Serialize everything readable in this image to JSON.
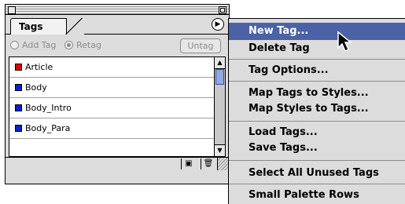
{
  "palette": {
    "tab_label": "Tags",
    "menu_button_icon": "triangle-right-icon",
    "options": {
      "add_tag_label": "Add Tag",
      "retag_label": "Retag",
      "selected": "Retag",
      "untag_label": "Untag"
    },
    "tags": [
      {
        "name": "Article",
        "color": "#e00000"
      },
      {
        "name": "Body",
        "color": "#0a1fd0"
      },
      {
        "name": "Body_Intro",
        "color": "#0a1fd0"
      },
      {
        "name": "Body_Para",
        "color": "#0a1fd0"
      }
    ],
    "bottom_icons": [
      "new-tag-icon",
      "trash-icon"
    ]
  },
  "menu": {
    "items": [
      {
        "label": "New Tag...",
        "highlighted": true
      },
      {
        "label": "Delete Tag"
      },
      {
        "label": "Tag Options..."
      },
      {
        "label": "Map Tags to Styles..."
      },
      {
        "label": "Map Styles to Tags..."
      },
      {
        "label": "Load Tags..."
      },
      {
        "label": "Save Tags..."
      },
      {
        "label": "Select All Unused Tags"
      },
      {
        "label": "Small Palette Rows"
      }
    ],
    "highlight_color": "#4b62a6"
  }
}
